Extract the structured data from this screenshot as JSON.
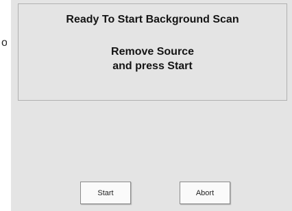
{
  "message": {
    "title": "Ready To Start Background Scan",
    "line1": "Remove Source",
    "line2": "and press Start"
  },
  "buttons": {
    "start_label": "Start",
    "abort_label": "Abort"
  },
  "colors": {
    "window_background": "#e4e4e4",
    "panel_border": "#b0b0b0",
    "text": "#141414"
  }
}
